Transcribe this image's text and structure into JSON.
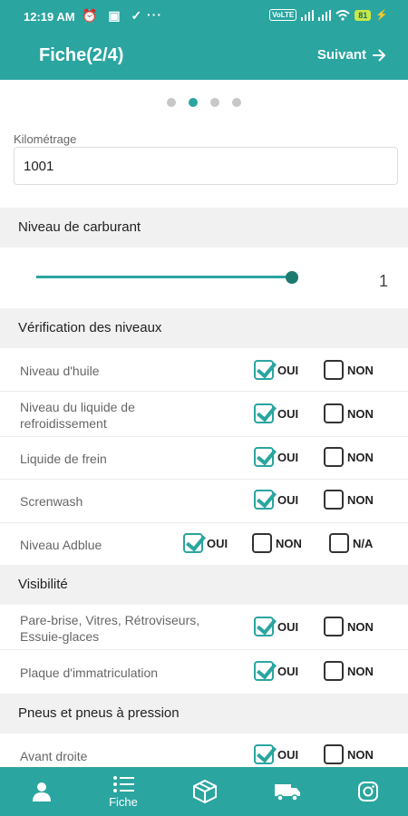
{
  "status": {
    "time": "12:19 AM",
    "icons": "⏰ ▣ ✓",
    "dots": "···",
    "volte": "VoLTE",
    "battery": "81"
  },
  "appbar": {
    "title": "Fiche(2/4)",
    "next_label": "Suivant"
  },
  "pager": {
    "count": 4,
    "active_index": 1
  },
  "kilometrage": {
    "label": "Kilométrage",
    "value": "1001"
  },
  "fuel": {
    "header": "Niveau de carburant",
    "value_text": "1",
    "level_fraction": 1.0
  },
  "sections": {
    "verification": "Vérification des niveaux",
    "visibility": "Visibilité",
    "tyres": "Pneus et pneus à pression"
  },
  "options": {
    "yes": "OUI",
    "no": "NON",
    "na": "N/A"
  },
  "rows": [
    {
      "label": "Niveau d'huile",
      "yes": true,
      "no": false
    },
    {
      "label": "Niveau du liquide de refroidissement",
      "yes": true,
      "no": false
    },
    {
      "label": "Liquide de frein",
      "yes": true,
      "no": false
    },
    {
      "label": "Screnwash",
      "yes": true,
      "no": false
    },
    {
      "label": "Niveau Adblue",
      "yes": true,
      "no": false,
      "na": false
    },
    {
      "label": "Pare-brise, Vitres, Rétroviseurs, Essuie-glaces",
      "yes": true,
      "no": false
    },
    {
      "label": "Plaque d'immatriculation",
      "yes": true,
      "no": false
    },
    {
      "label": "Avant droite",
      "yes": true,
      "no": false
    }
  ],
  "bottom_nav": [
    {
      "icon": "person-icon",
      "label": ""
    },
    {
      "icon": "list-icon",
      "label": "Fiche",
      "active": true
    },
    {
      "icon": "box-icon",
      "label": ""
    },
    {
      "icon": "truck-icon",
      "label": ""
    },
    {
      "icon": "instagram-icon",
      "label": ""
    }
  ]
}
